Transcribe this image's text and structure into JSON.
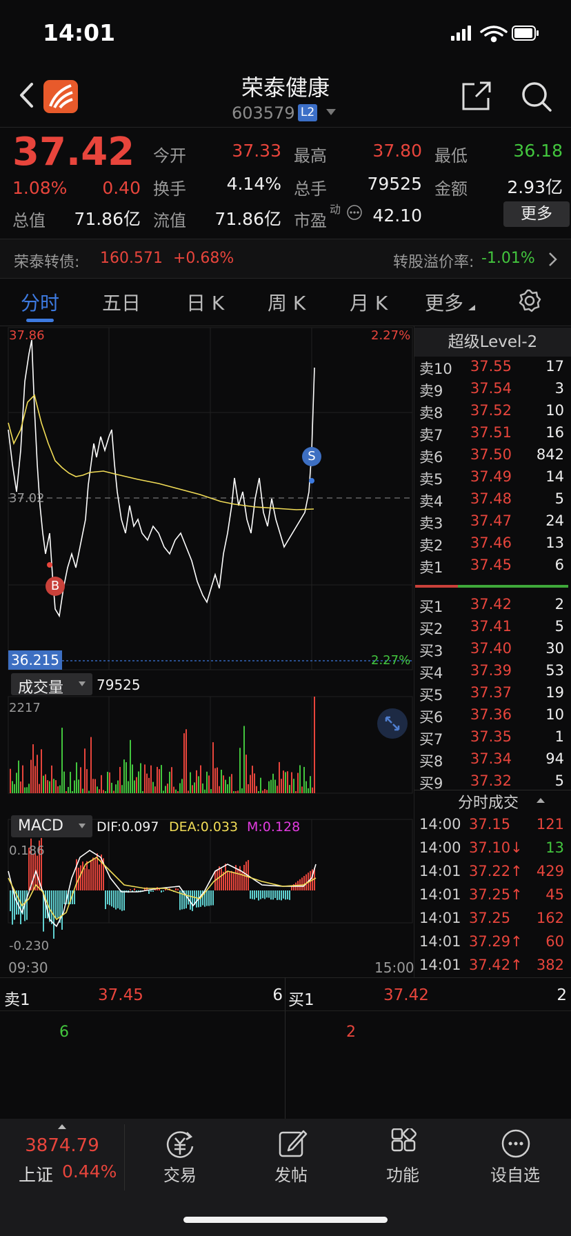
{
  "status": {
    "time": "14:01"
  },
  "header": {
    "title": "荣泰健康",
    "code": "603579",
    "badge": "L2"
  },
  "quote": {
    "price": "37.42",
    "change_pct": "1.08%",
    "change": "0.40",
    "open_label": "今开",
    "open": "37.33",
    "high_label": "最高",
    "high": "37.80",
    "low_label": "最低",
    "low": "36.18",
    "turnover_label": "换手",
    "turnover": "4.14%",
    "volume_label": "总手",
    "volume": "79525",
    "amount_label": "金额",
    "amount": "2.93亿",
    "mktcap_label": "总值",
    "mktcap": "71.86亿",
    "float_label": "流值",
    "float": "71.86亿",
    "pe_label": "市盈",
    "pe_sup": "动",
    "pe": "42.10",
    "more": "更多"
  },
  "bond": {
    "label": "荣泰转债:",
    "price": "160.571",
    "change": "+0.68%",
    "premium_label": "转股溢价率:",
    "premium": "-1.01%"
  },
  "tabs": [
    "分时",
    "五日",
    "日 K",
    "周 K",
    "月 K",
    "更多"
  ],
  "chart_labels": {
    "top_price": "37.86",
    "top_pct": "2.27%",
    "mid_price": "37.02",
    "low_price": "36.215",
    "low_pct": "2.27%",
    "vol_label": "成交量",
    "vol_value": "79525",
    "vol_max": "2217",
    "macd_label": "MACD",
    "dif": "DIF:0.097",
    "dea": "DEA:0.033",
    "m": "M:0.128",
    "macd_max": "0.186",
    "macd_min": "-0.230",
    "time_start": "09:30",
    "time_end": "15:00",
    "buy_marker": "B",
    "sell_marker": "S"
  },
  "colors": {
    "up": "#e8453c",
    "down": "#43c63e",
    "accent": "#3d7ae0",
    "avg_line": "#f2dd57",
    "price_line": "#ffffff"
  },
  "order_book": {
    "title": "超级Level-2",
    "asks": [
      {
        "label": "卖10",
        "price": "37.55",
        "vol": "17"
      },
      {
        "label": "卖9",
        "price": "37.54",
        "vol": "3"
      },
      {
        "label": "卖8",
        "price": "37.52",
        "vol": "10"
      },
      {
        "label": "卖7",
        "price": "37.51",
        "vol": "16"
      },
      {
        "label": "卖6",
        "price": "37.50",
        "vol": "842"
      },
      {
        "label": "卖5",
        "price": "37.49",
        "vol": "14"
      },
      {
        "label": "卖4",
        "price": "37.48",
        "vol": "5"
      },
      {
        "label": "卖3",
        "price": "37.47",
        "vol": "24"
      },
      {
        "label": "卖2",
        "price": "37.46",
        "vol": "13"
      },
      {
        "label": "卖1",
        "price": "37.45",
        "vol": "6"
      }
    ],
    "bids": [
      {
        "label": "买1",
        "price": "37.42",
        "vol": "2"
      },
      {
        "label": "买2",
        "price": "37.41",
        "vol": "5"
      },
      {
        "label": "买3",
        "price": "37.40",
        "vol": "30"
      },
      {
        "label": "买4",
        "price": "37.39",
        "vol": "53"
      },
      {
        "label": "买5",
        "price": "37.37",
        "vol": "19"
      },
      {
        "label": "买6",
        "price": "37.36",
        "vol": "10"
      },
      {
        "label": "买7",
        "price": "37.35",
        "vol": "1"
      },
      {
        "label": "买8",
        "price": "37.34",
        "vol": "94"
      },
      {
        "label": "买9",
        "price": "37.32",
        "vol": "5"
      }
    ]
  },
  "trades": {
    "title": "分时成交",
    "rows": [
      {
        "time": "14:00",
        "price": "37.15",
        "vol": "121",
        "dir": "",
        "vcolor": "up"
      },
      {
        "time": "14:00",
        "price": "37.10↓",
        "vol": "13",
        "dir": "down",
        "vcolor": "down"
      },
      {
        "time": "14:01",
        "price": "37.22↑",
        "vol": "429",
        "dir": "up",
        "vcolor": "up"
      },
      {
        "time": "14:01",
        "price": "37.25↑",
        "vol": "45",
        "dir": "up",
        "vcolor": "up"
      },
      {
        "time": "14:01",
        "price": "37.25",
        "vol": "162",
        "dir": "",
        "vcolor": "up"
      },
      {
        "time": "14:01",
        "price": "37.29↑",
        "vol": "60",
        "dir": "up",
        "vcolor": "up"
      },
      {
        "time": "14:01",
        "price": "37.42↑",
        "vol": "382",
        "dir": "up",
        "vcolor": "up"
      }
    ]
  },
  "bottom_quote": {
    "ask_label": "卖1",
    "ask_price": "37.45",
    "ask_vol": "6",
    "ask_sub": "6",
    "bid_label": "买1",
    "bid_price": "37.42",
    "bid_vol": "2",
    "bid_sub": "2"
  },
  "bottom_nav": {
    "index_value": "3874.79",
    "index_name": "上证",
    "index_pct": "0.44%",
    "items": [
      "交易",
      "发帖",
      "功能",
      "设自选"
    ]
  }
}
